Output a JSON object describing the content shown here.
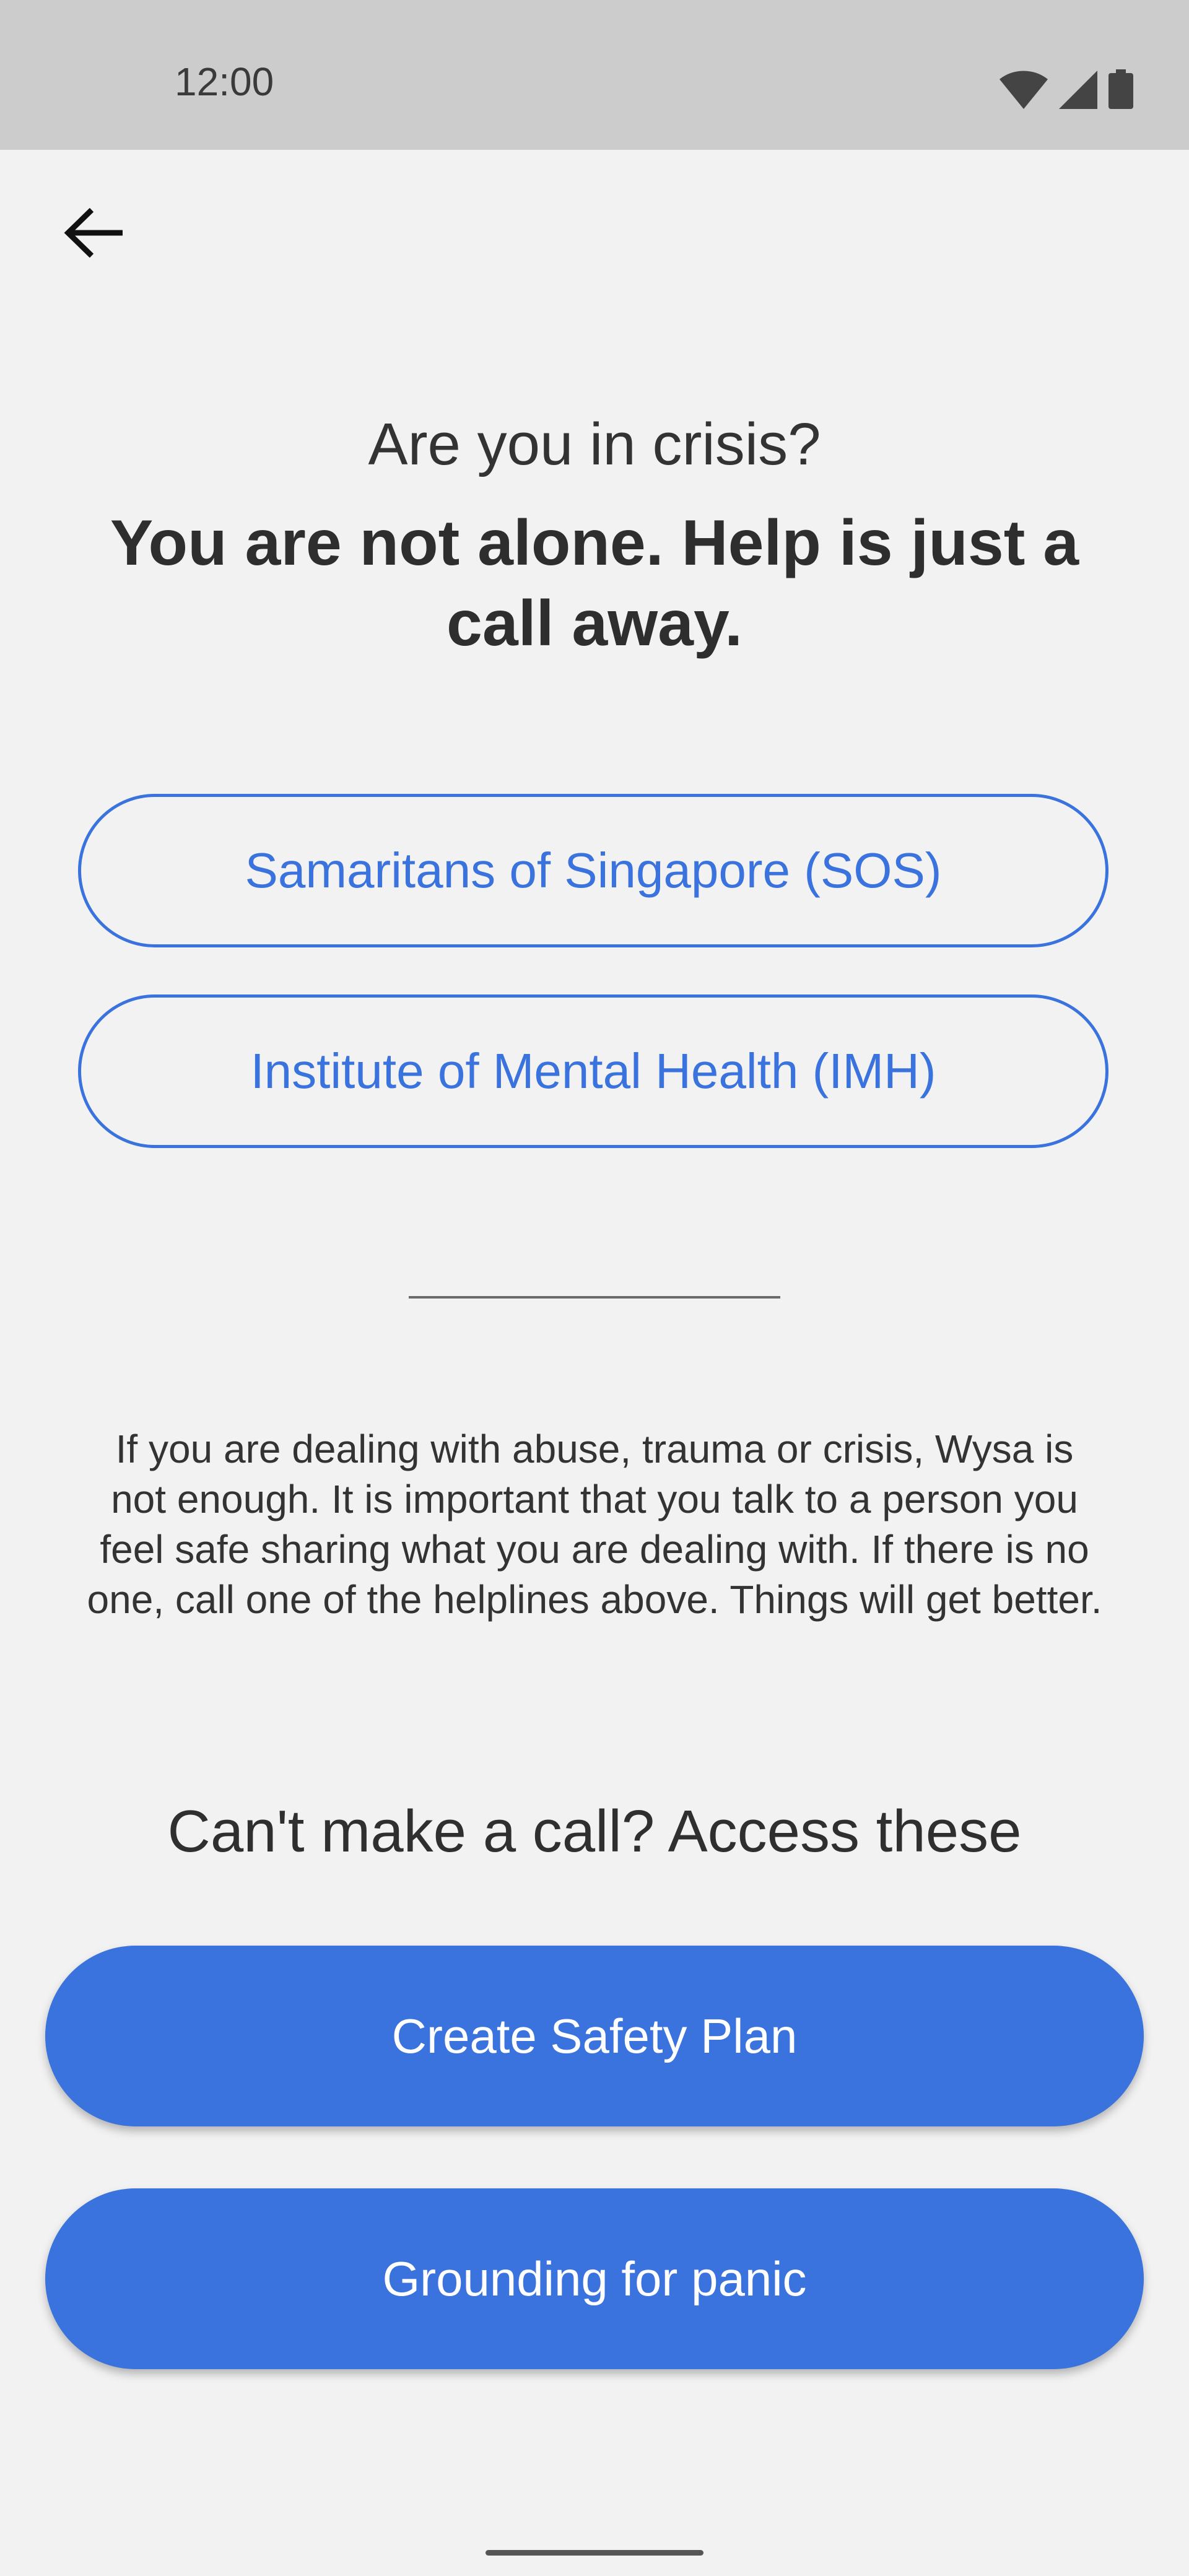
{
  "status_bar": {
    "time": "12:00",
    "icons": [
      "wifi-icon",
      "cellular-signal-icon",
      "battery-icon"
    ]
  },
  "header": {
    "back_icon": "arrow-left-icon"
  },
  "main": {
    "question": "Are you in crisis?",
    "headline": "You are not alone. Help is just a call away.",
    "helplines": [
      {
        "label": "Samaritans of Singapore (SOS)"
      },
      {
        "label": "Institute of Mental Health (IMH)"
      }
    ],
    "info_text": "If you are dealing with abuse, trauma or crisis, Wysa is not enough. It is important that you talk to a person you feel safe sharing what you are dealing with. If there is no one, call one of the helplines above. Things will get better.",
    "alt_heading": "Can't make a call? Access these",
    "actions": [
      {
        "label": "Create Safety Plan"
      },
      {
        "label": "Grounding for panic"
      }
    ]
  },
  "colors": {
    "accent": "#3a72de",
    "background": "#f2f2f2",
    "status_bar": "#cccccc"
  }
}
